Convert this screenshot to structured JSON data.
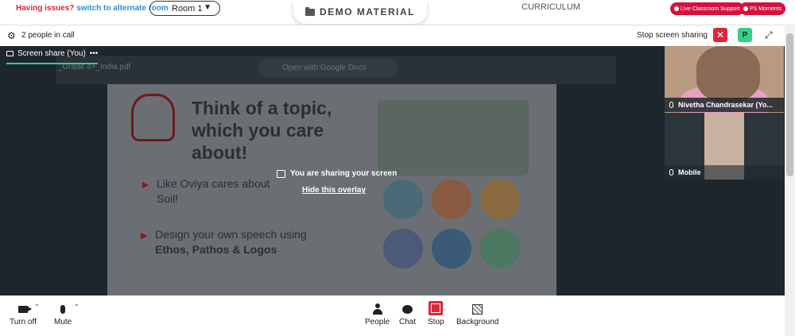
{
  "topbar": {
    "issues_text": "Having issues?",
    "alternate_link": "switch to alternate room",
    "room_value": "Room 1",
    "demo_label": "DEMO MATERIAL",
    "curriculum_label": "CURRICULUM",
    "live_support_label": "Live Classroom Support",
    "ps_moments_label": "PS Moments"
  },
  "callbar": {
    "people_count": "2 people in call",
    "stop_share_label": "Stop screen sharing",
    "p_badge": "P"
  },
  "stage": {
    "share_tab_label": "Screen share (You)",
    "share_tab_more": "•••",
    "pdf_name": "_Grade 4+_India.pdf",
    "gdocs_label": "Open with Google Docs",
    "slide": {
      "title": "Think of a topic, which you care about!",
      "bullet1": "Like Oviya cares about Soil!",
      "bullet2_line1": "Design your own speech using",
      "bullet2_line2": "Ethos, Pathos & Logos"
    },
    "overlay_text": "You are sharing your screen",
    "hide_overlay": "Hide this overlay"
  },
  "tiles": [
    {
      "name": "Nivetha Chandrasekar (Yo..."
    },
    {
      "name": "Mobile"
    }
  ],
  "controls": {
    "turn_off": "Turn off",
    "mute": "Mute",
    "people": "People",
    "chat": "Chat",
    "stop": "Stop",
    "background": "Background"
  },
  "colors": {
    "accent_green": "#2fd38a",
    "danger_red": "#e0263b",
    "brand_pink": "#d6103f",
    "stage_bg": "#1d262d"
  }
}
